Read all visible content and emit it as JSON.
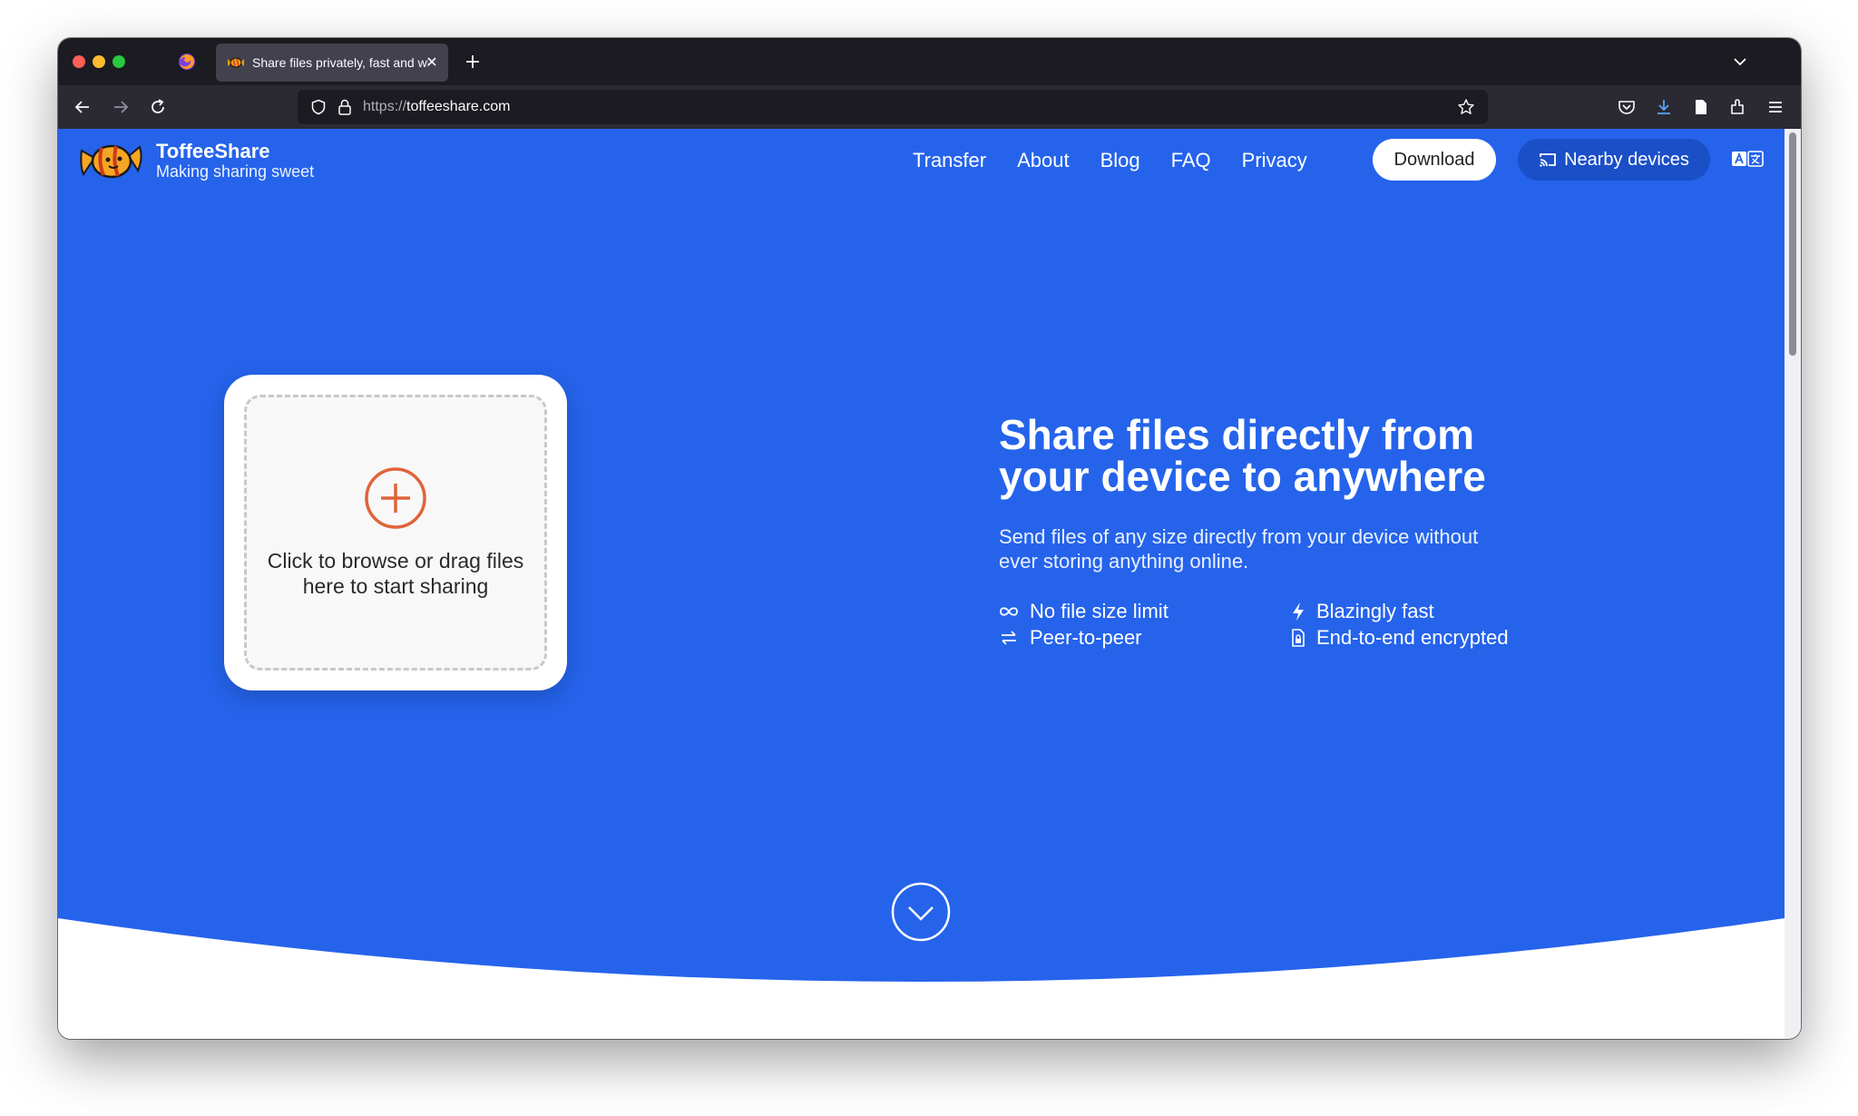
{
  "browser": {
    "tab_title": "Share files privately, fast and with",
    "url_protocol": "https://",
    "url_host": "toffeeshare.com"
  },
  "header": {
    "brand_name": "ToffeeShare",
    "brand_tagline": "Making sharing sweet",
    "nav": [
      "Transfer",
      "About",
      "Blog",
      "FAQ",
      "Privacy"
    ],
    "download_label": "Download",
    "nearby_label": "Nearby devices"
  },
  "upload": {
    "prompt": "Click to browse or drag files here to start sharing"
  },
  "hero": {
    "title": "Share files directly from your device to anywhere",
    "subtitle": "Send files of any size directly from your device without ever storing anything online.",
    "features": [
      {
        "label": "No file size limit",
        "icon": "infinity-icon"
      },
      {
        "label": "Blazingly fast",
        "icon": "lightning-icon"
      },
      {
        "label": "Peer-to-peer",
        "icon": "swap-arrows-icon"
      },
      {
        "label": "End-to-end encrypted",
        "icon": "lock-file-icon"
      }
    ]
  },
  "colors": {
    "hero_blue": "#2563eb",
    "accent_orange": "#e0633a",
    "nearby_button": "#1b4fc7"
  }
}
